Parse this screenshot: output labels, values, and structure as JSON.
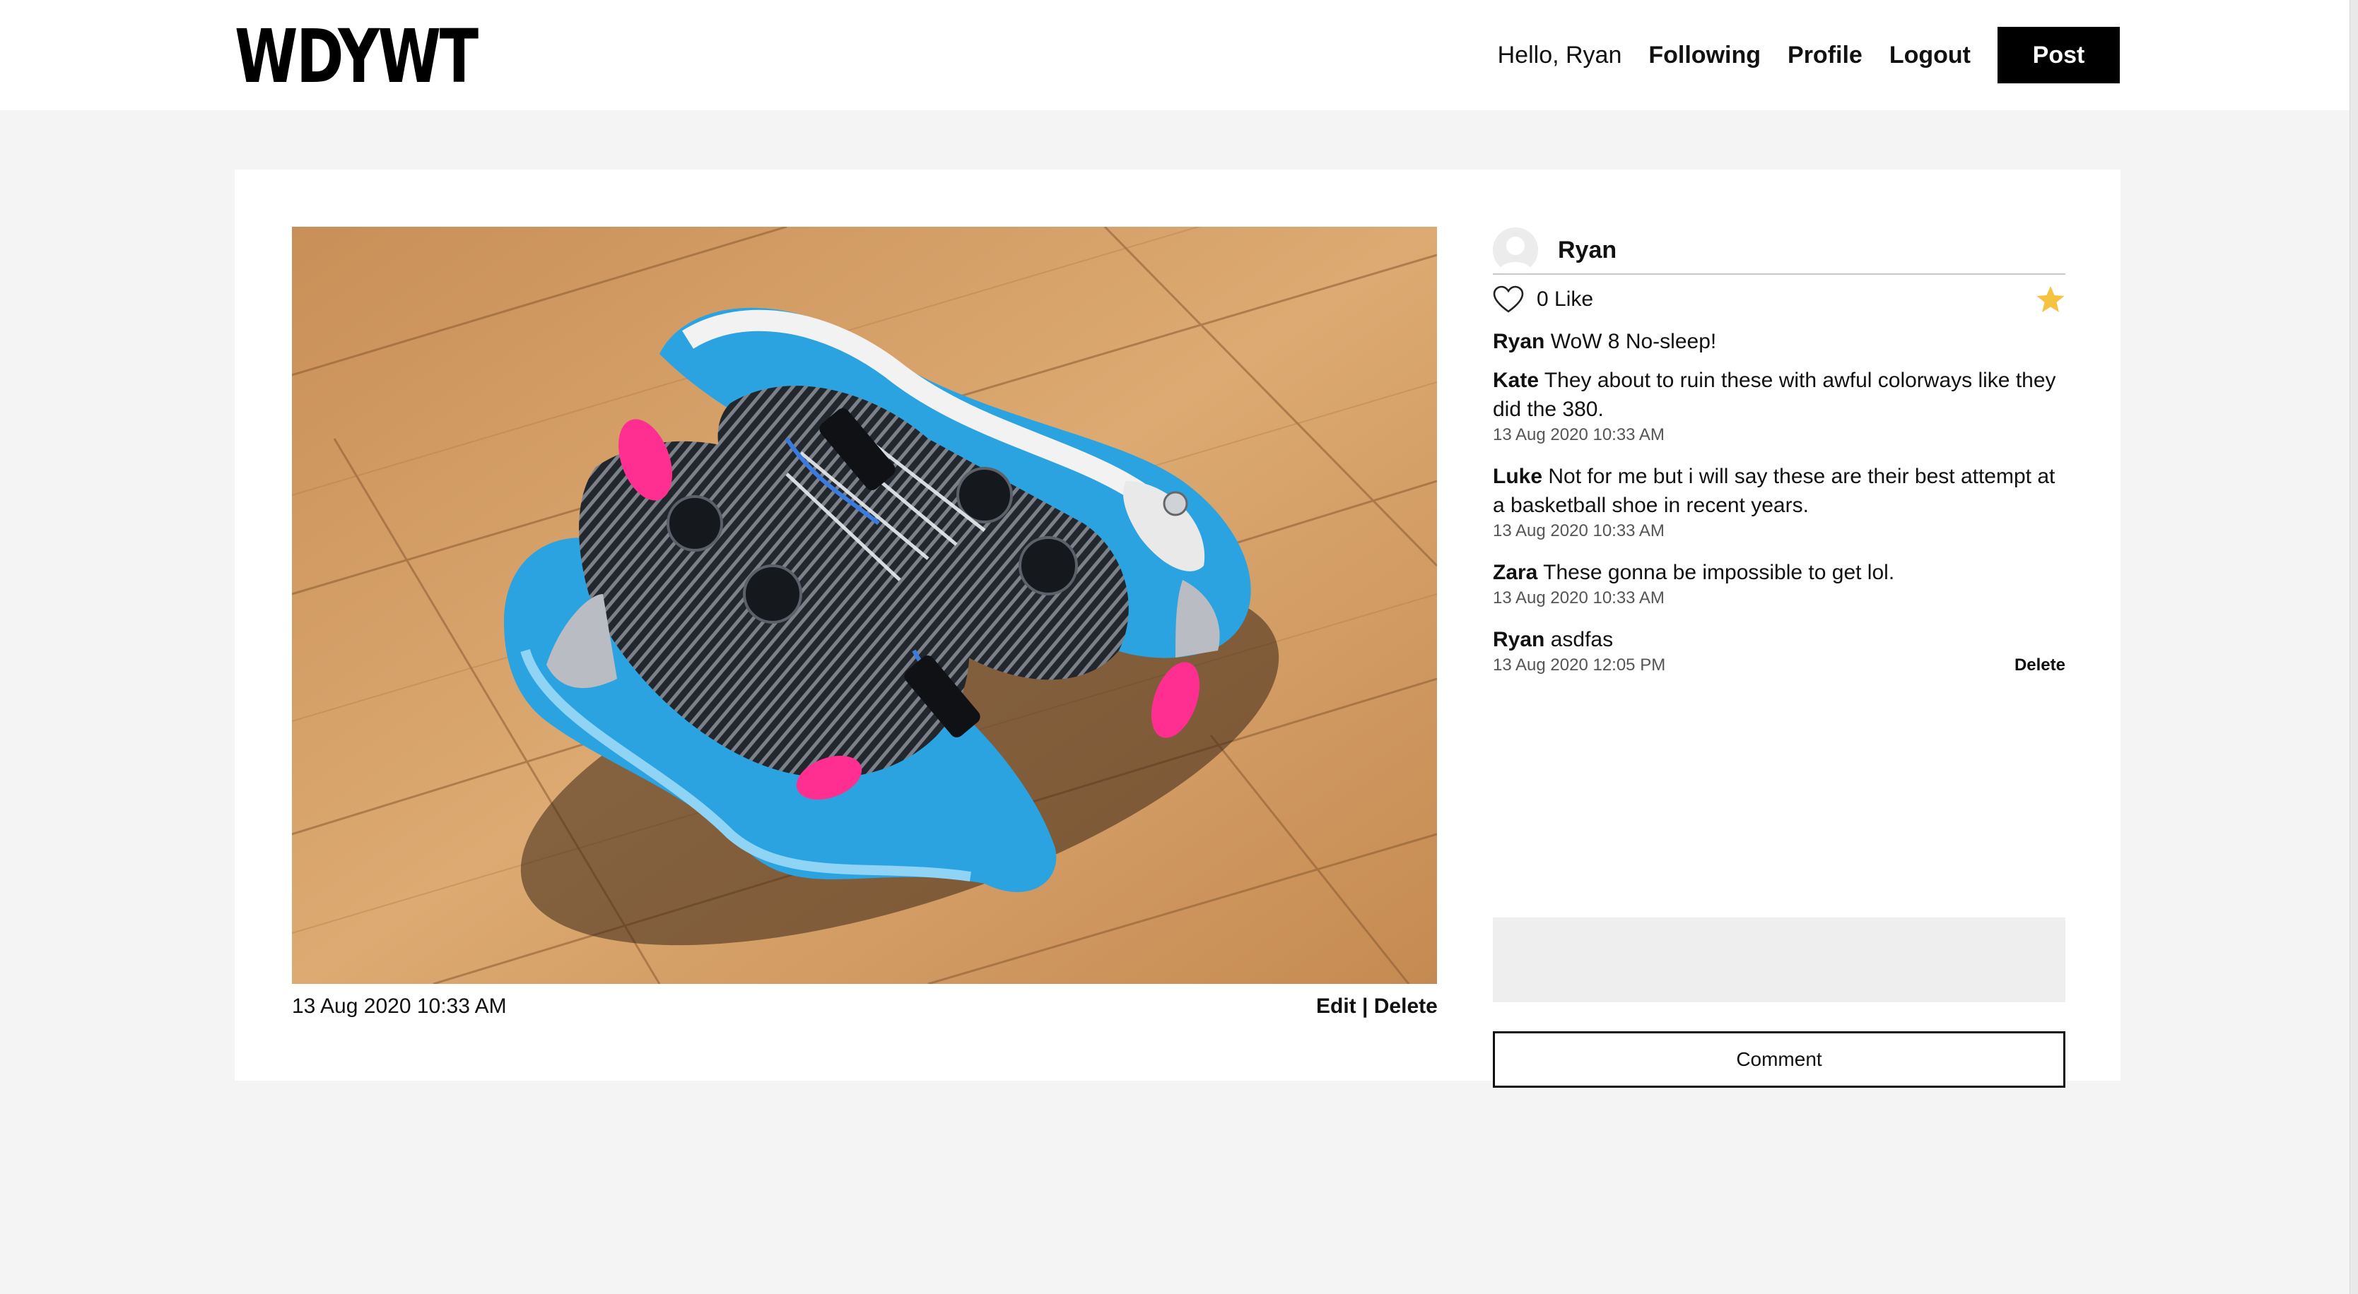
{
  "header": {
    "logo": "WDYWT",
    "greeting": "Hello, Ryan",
    "nav": [
      "Following",
      "Profile",
      "Logout"
    ],
    "post_label": "Post"
  },
  "post": {
    "image_alt": "Basketball sneaker on wooden floor",
    "date": "13 Aug 2020 10:33 AM",
    "edit_label": "Edit",
    "separator": "|",
    "delete_label": "Delete"
  },
  "panel": {
    "author": "Ryan",
    "likes_text": "0 Like",
    "favorited": true,
    "comments": [
      {
        "user": "Ryan",
        "text": "WoW 8 No-sleep!",
        "time": "",
        "deletable": false
      },
      {
        "user": "Kate",
        "text": "They about to ruin these with awful colorways like they did the 380.",
        "time": "13 Aug 2020 10:33 AM",
        "deletable": false
      },
      {
        "user": "Luke",
        "text": "Not for me but i will say these are their best attempt at a basketball shoe in recent years.",
        "time": "13 Aug 2020 10:33 AM",
        "deletable": false
      },
      {
        "user": "Zara",
        "text": "These gonna be impossible to get lol.",
        "time": "13 Aug 2020 10:33 AM",
        "deletable": false
      },
      {
        "user": "Ryan",
        "text": "asdfas",
        "time": "13 Aug 2020 12:05 PM",
        "deletable": true,
        "delete_label": "Delete"
      }
    ],
    "comment_placeholder": "",
    "comment_button": "Comment"
  },
  "colors": {
    "accent_star": "#f5c242",
    "button_bg": "#000000",
    "page_bg": "#f4f4f4",
    "input_bg": "#eeeeee"
  }
}
